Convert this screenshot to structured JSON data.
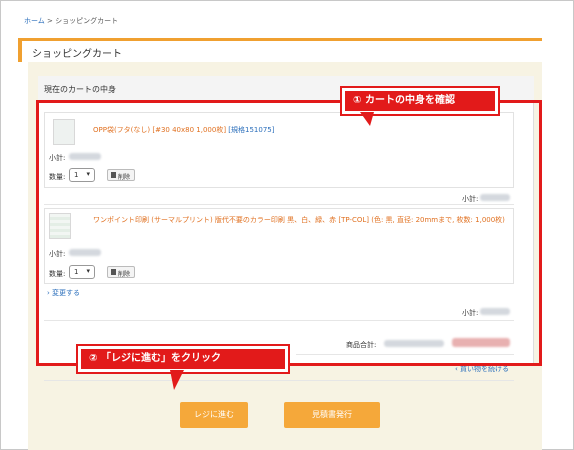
{
  "breadcrumb": {
    "home": "ホーム",
    "separator": ">",
    "current": "ショッピングカート"
  },
  "page_title": "ショッピングカート",
  "cart_title": "現在のカートの中身",
  "items": [
    {
      "name": "OPP袋(フタ(なし) [#30 40x80 1,000枚]",
      "code": "[規格151075]",
      "subtotal_label": "小計:",
      "qty_label": "数量:",
      "qty_value": "1",
      "delete_label": "削除"
    },
    {
      "name": "ワンポイント印刷 (サーマルプリント) 版代不要のカラー印刷 黒、白、緑、赤 [TP-COL] (色: 黒, 直径: 20mmまで, 枚数: 1,000枚)",
      "code": "",
      "subtotal_label": "小計:",
      "qty_label": "数量:",
      "qty_value": "1",
      "delete_label": "削除"
    }
  ],
  "row_subtotal_label": "小計:",
  "change_link": "変更する",
  "product_total_label": "商品合計:",
  "back_link": "買い物を続ける",
  "buttons": {
    "checkout": "レジに進む",
    "quote": "見積書発行"
  },
  "callouts": {
    "step1": "① カートの中身を確認",
    "step2": "② 「レジに進む」をクリック"
  },
  "colors": {
    "accent": "#f5a83a",
    "highlight": "#e21a1a",
    "link": "#2a6ebb",
    "product_name": "#e07020"
  }
}
